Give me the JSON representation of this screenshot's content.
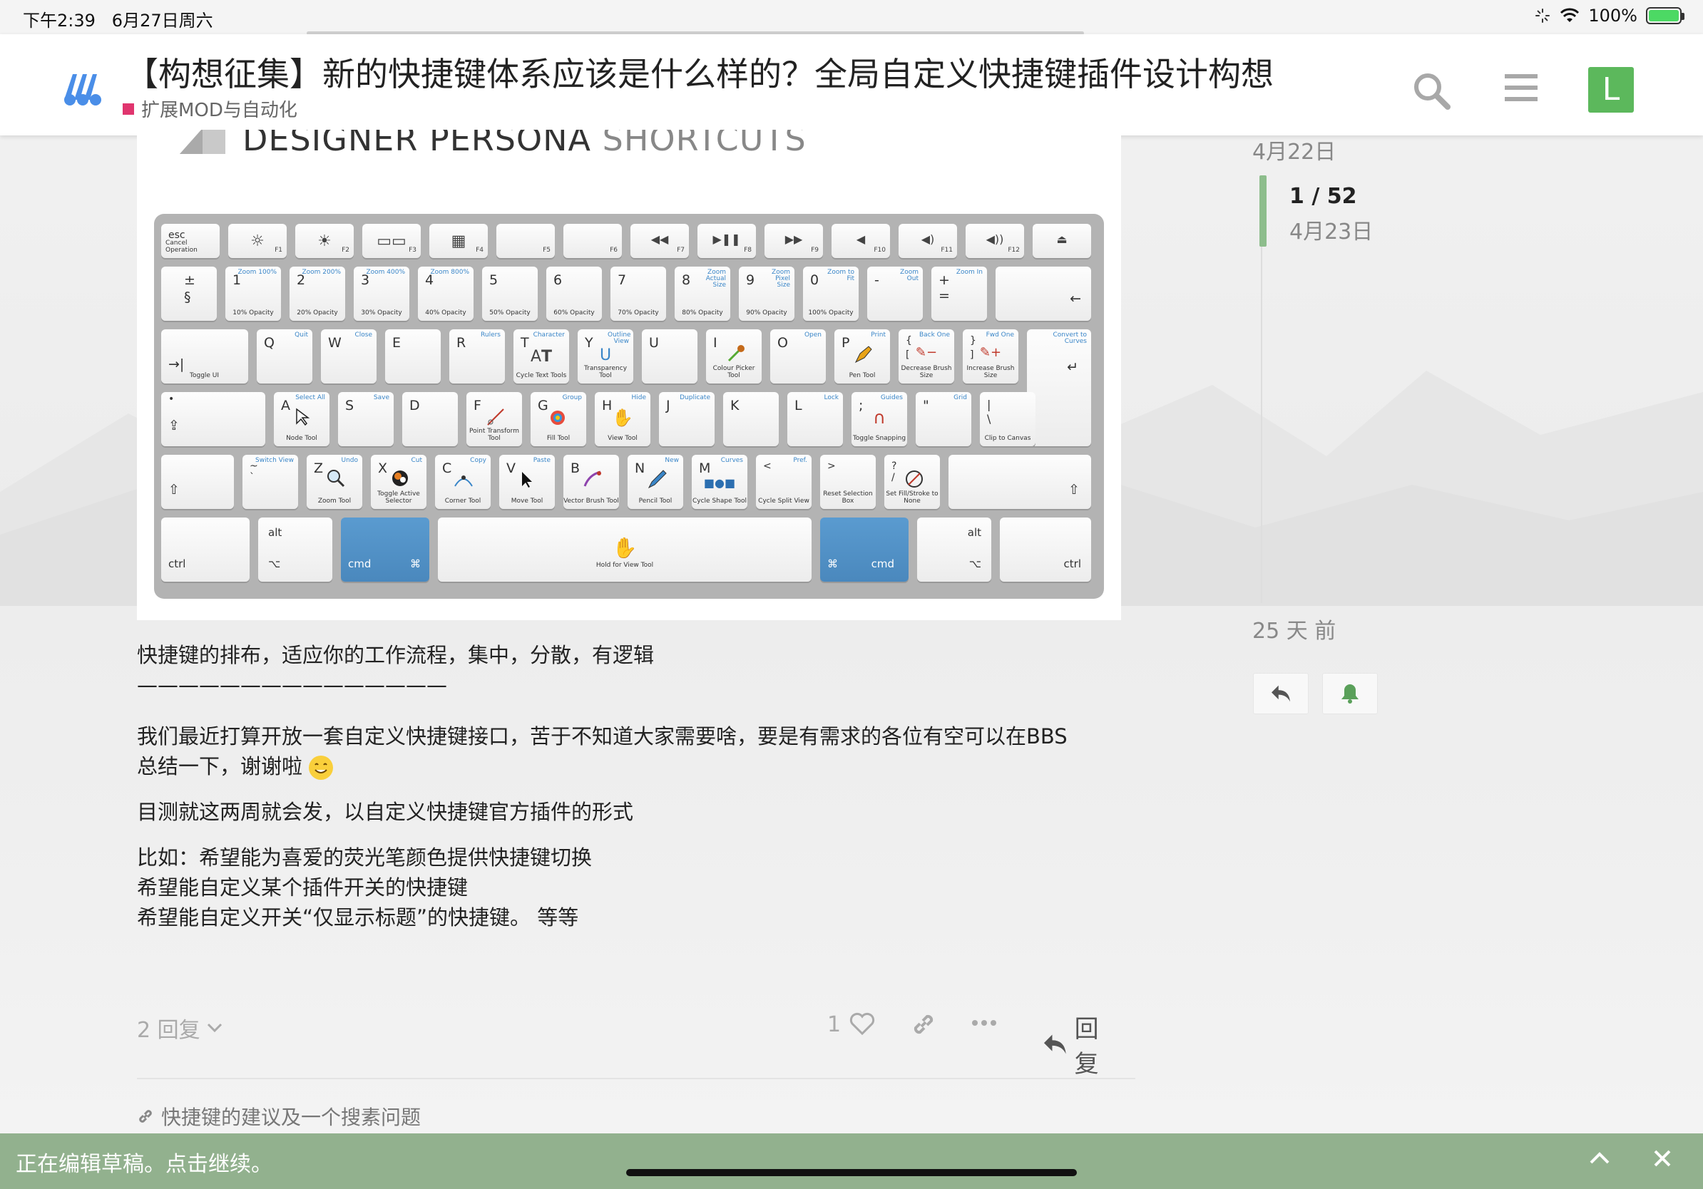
{
  "status_bar": {
    "time": "下午2:39",
    "date": "6月27日周六",
    "battery": "100%"
  },
  "header": {
    "title": "【构想征集】新的快捷键体系应该是什么样的？全局自定义快捷键插件设计构想",
    "category": "扩展MOD与自动化",
    "category_color": "#e0356e",
    "avatar_letter": "L",
    "avatar_color": "#5cb85c"
  },
  "image": {
    "title_dark": "DESIGNER PERSONA",
    "title_light": "SHORTCUTS",
    "keys": {
      "esc": "esc",
      "esc_label": "Cancel Operation",
      "f1": "F1",
      "f2": "F2",
      "f3": "F3",
      "f4": "F4",
      "f5": "F5",
      "f6": "F6",
      "f7": "F7",
      "f8": "F8",
      "f9": "F9",
      "f10": "F10",
      "f11": "F11",
      "f12": "F12",
      "n_pm": "±",
      "n_ss": "§",
      "n1": "1",
      "n1_l": "10% Opacity",
      "n1_t": "Zoom 100%",
      "n2": "2",
      "n2_l": "20% Opacity",
      "n2_t": "Zoom 200%",
      "n3": "3",
      "n3_l": "30% Opacity",
      "n3_t": "Zoom 400%",
      "n4": "4",
      "n4_l": "40% Opacity",
      "n4_t": "Zoom 800%",
      "n5": "5",
      "n5_l": "50% Opacity",
      "n6": "6",
      "n6_l": "60% Opacity",
      "n7": "7",
      "n7_l": "70% Opacity",
      "n8": "8",
      "n8_l": "80% Opacity",
      "n8_t": "Zoom Actual Size",
      "n9": "9",
      "n9_l": "90% Opacity",
      "n9_t": "Zoom Pixel Size",
      "n0": "0",
      "n0_l": "100% Opacity",
      "n0_t": "Zoom to Fit",
      "minus": "-",
      "minus_t": "Zoom Out",
      "plus": "+",
      "plus_eq": "=",
      "plus_t": "Zoom In",
      "backspace": "←",
      "tab_l": "Toggle UI",
      "q": "Q",
      "q_t": "Quit",
      "w": "W",
      "w_t": "Close",
      "e": "E",
      "r": "R",
      "r_t": "Rulers",
      "t": "T",
      "t_l": "Cycle Text Tools",
      "t_t": "Character",
      "y": "Y",
      "y_l": "Transparency Tool",
      "y_t": "Outline View",
      "u": "U",
      "i": "I",
      "i_l": "Colour Picker Tool",
      "o": "O",
      "o_t": "Open",
      "p": "P",
      "p_l": "Pen Tool",
      "p_t": "Print",
      "lb": "{",
      "lb2": "[",
      "lb_l": "Decrease Brush Size",
      "lb_t": "Back One",
      "rb": "}",
      "rb2": "]",
      "rb_l": "Increase Brush Size",
      "rb_t": "Fwd One",
      "enter_t": "Convert to Curves",
      "a": "A",
      "a_l": "Node Tool",
      "a_t": "Select All",
      "s": "S",
      "s_t": "Save",
      "d": "D",
      "f": "F",
      "f_l": "Point Transform Tool",
      "g": "G",
      "g_l": "Fill Tool",
      "g_t": "Group",
      "h": "H",
      "h_l": "View Tool",
      "h_t": "Hide",
      "j": "J",
      "j_t": "Duplicate",
      "k": "K",
      "l": "L",
      "l_t": "Lock",
      "semi": ";",
      "semi_l": "Toggle Snapping",
      "semi_t": "Guides",
      "quote": "\"",
      "quote_t": "Grid",
      "pipe": "|",
      "pipe_b": "\\",
      "pipe_l": "Clip to Canvas",
      "tilde": "~",
      "tilde_b": "`",
      "tilde_t": "Switch View",
      "z": "Z",
      "z_l": "Zoom Tool",
      "z_t": "Undo",
      "x": "X",
      "x_l": "Toggle Active Selector",
      "x_t": "Cut",
      "c": "C",
      "c_l": "Corner Tool",
      "c_t": "Copy",
      "v": "V",
      "v_l": "Move Tool",
      "v_t": "Paste",
      "b": "B",
      "b_l": "Vector Brush Tool",
      "n": "N",
      "n_l": "Pencil Tool",
      "n_t": "New",
      "m": "M",
      "m_l": "Cycle Shape Tool",
      "m_t": "Curves",
      "lt": "<",
      "lt_l": "Cycle Split View",
      "lt_t": "Pref.",
      "gt": ">",
      "gt_l": "Reset Selection Box",
      "q2": "?",
      "q2_b": "/",
      "q2_l": "Set Fill/Stroke to None",
      "ctrl": "ctrl",
      "alt": "alt",
      "cmd": "cmd",
      "cmd_sym": "⌘",
      "opt_sym": "⌥",
      "space_l": "Hold for View Tool"
    }
  },
  "post": {
    "line1": "快捷键的排布，适应你的工作流程，集中，分散，有逻辑",
    "line2": "———————————————",
    "para1a": "我们最近打算开放一套自定义快捷键接口，苦于不知道大家需要啥，要是有需求的各位有空可以在BBS",
    "para1b": "总结一下，谢谢啦",
    "para2": "目测就这两周就会发，以自定义快捷键官方插件的形式",
    "para3a": "比如：希望能为喜爱的荧光笔颜色提供快捷键切换",
    "para3b": "希望能自定义某个插件开关的快捷键",
    "para3c": "希望能自定义开关“仅显示标题”的快捷键。 等等"
  },
  "actions": {
    "replies": "2 回复",
    "likes": "1",
    "reply": "回复"
  },
  "linked_topic": "快捷键的建议及一个搜素问题",
  "timeline": {
    "start_date": "4月22日",
    "position": "1 / 52",
    "current_date": "4月23日",
    "end_date": "25 天 前"
  },
  "draft_bar": {
    "message": "正在编辑草稿。点击继续。",
    "color": "#92b18e"
  }
}
